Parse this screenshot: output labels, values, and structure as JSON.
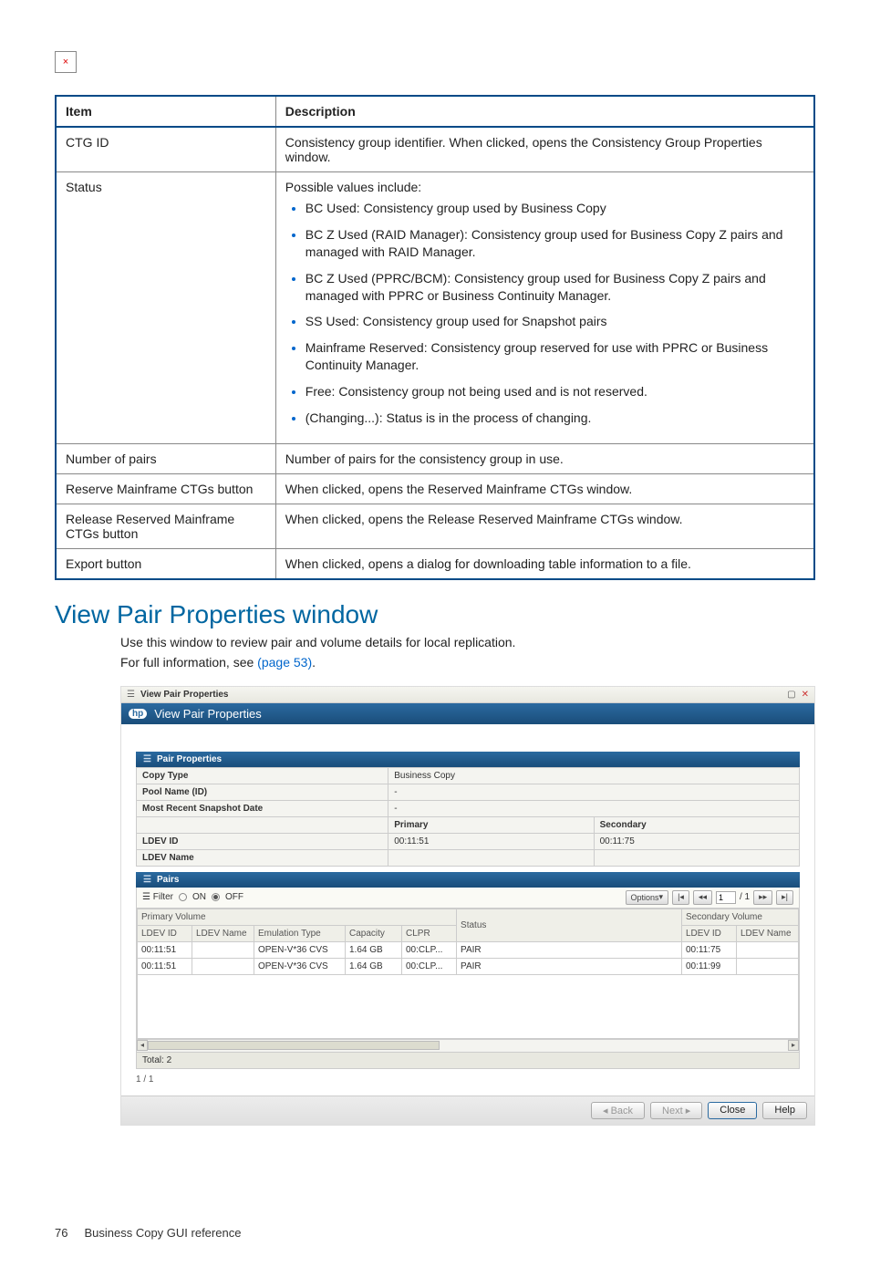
{
  "broken_img_glyph": "×",
  "doc_table": {
    "headers": [
      "Item",
      "Description"
    ],
    "rows": [
      {
        "item": "CTG ID",
        "desc_text": "Consistency group identifier. When clicked, opens the Consistency Group Properties window."
      },
      {
        "item": "Status",
        "desc_lead": "Possible values include:",
        "bullets": [
          "BC Used: Consistency group used by Business Copy",
          "BC Z Used (RAID Manager): Consistency group used for Business Copy Z pairs and managed with RAID Manager.",
          "BC Z Used (PPRC/BCM): Consistency group used for Business Copy Z pairs and managed with PPRC or Business Continuity Manager.",
          "SS Used: Consistency group used for Snapshot pairs",
          "Mainframe Reserved: Consistency group reserved for use with PPRC or Business Continuity Manager.",
          "Free: Consistency group not being used and is not reserved.",
          "(Changing...): Status is in the process of changing."
        ]
      },
      {
        "item": "Number of pairs",
        "desc_text": "Number of pairs for the consistency group in use."
      },
      {
        "item": "Reserve Mainframe CTGs button",
        "desc_text": "When clicked, opens the Reserved Mainframe CTGs window."
      },
      {
        "item": "Release Reserved Mainframe CTGs button",
        "desc_text": "When clicked, opens the Release Reserved Mainframe CTGs window."
      },
      {
        "item": "Export button",
        "desc_text": "When clicked, opens a dialog for downloading table information to a file."
      }
    ]
  },
  "section_heading": "View Pair Properties window",
  "section_para1": "Use this window to review pair and volume details for local replication.",
  "section_para2a": "For full information, see ",
  "section_para2_link": "(page 53)",
  "section_para2b": ".",
  "shot": {
    "titlebar": {
      "chev": "☰",
      "title": "View Pair Properties",
      "max": "▢",
      "close": "✕"
    },
    "hpbar": {
      "logo": "hp",
      "title": "View Pair Properties"
    },
    "pair_props": {
      "header": "Pair Properties",
      "rows": {
        "copy_type": {
          "label": "Copy Type",
          "value": "Business Copy"
        },
        "pool_name": {
          "label": "Pool Name (ID)",
          "value": "-"
        },
        "snap_date": {
          "label": "Most Recent Snapshot Date",
          "value": "-"
        }
      },
      "col_primary": "Primary",
      "col_secondary": "Secondary",
      "ldev_id": {
        "label": "LDEV ID",
        "primary": "00:11:51",
        "secondary": "00:11:75"
      },
      "ldev_name": {
        "label": "LDEV Name",
        "primary": "",
        "secondary": ""
      }
    },
    "pairs": {
      "header": "Pairs",
      "filter_label": "Filter",
      "on_label": "ON",
      "off_label": "OFF",
      "options_label": "Options",
      "page_input": "1",
      "page_total": "/ 1",
      "group_primary": "Primary Volume",
      "group_status": "Status",
      "group_secondary": "Secondary Volume",
      "cols": {
        "ldev_id": "LDEV ID",
        "ldev_name": "LDEV Name",
        "emu": "Emulation Type",
        "cap": "Capacity",
        "clpr": "CLPR",
        "sec_ldev_id": "LDEV ID",
        "sec_ldev_name": "LDEV Name"
      },
      "rows": [
        {
          "ldev_id": "00:11:51",
          "ldev_name": "",
          "emu": "OPEN-V*36 CVS",
          "cap": "1.64 GB",
          "clpr": "00:CLP...",
          "status": "PAIR",
          "sec_ldev_id": "00:11:75",
          "sec_ldev_name": ""
        },
        {
          "ldev_id": "00:11:51",
          "ldev_name": "",
          "emu": "OPEN-V*36 CVS",
          "cap": "1.64 GB",
          "clpr": "00:CLP...",
          "status": "PAIR",
          "sec_ldev_id": "00:11:99",
          "sec_ldev_name": ""
        }
      ],
      "total_label": "Total:  2",
      "pager": "1 / 1"
    },
    "footer": {
      "back": "◂ Back",
      "next": "Next ▸",
      "close": "Close",
      "help": "Help"
    }
  },
  "page_footer": {
    "num": "76",
    "title": "Business Copy GUI reference"
  }
}
